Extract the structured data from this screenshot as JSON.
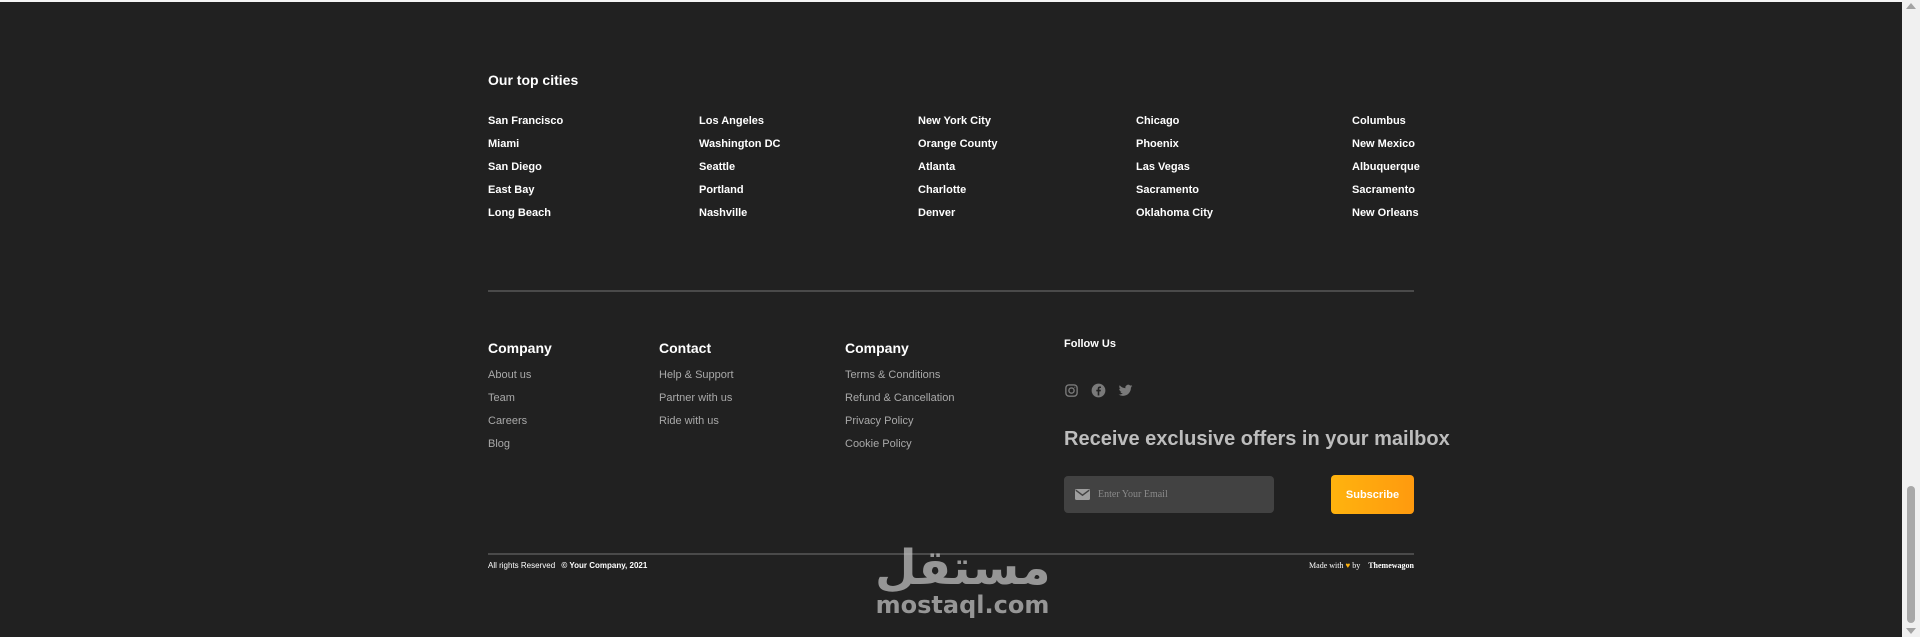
{
  "cities": {
    "heading": "Our top cities",
    "columns": [
      [
        "San Francisco",
        "Miami",
        "San Diego",
        "East Bay",
        "Long Beach"
      ],
      [
        "Los Angeles",
        "Washington DC",
        "Seattle",
        "Portland",
        "Nashville"
      ],
      [
        "New York City",
        "Orange County",
        "Atlanta",
        "Charlotte",
        "Denver"
      ],
      [
        "Chicago",
        "Phoenix",
        "Las Vegas",
        "Sacramento",
        "Oklahoma City"
      ],
      [
        "Columbus",
        "New Mexico",
        "Albuquerque",
        "Sacramento",
        "New Orleans"
      ]
    ]
  },
  "footer": {
    "company1": {
      "title": "Company",
      "links": [
        "About us",
        "Team",
        "Careers",
        "Blog"
      ]
    },
    "contact": {
      "title": "Contact",
      "links": [
        "Help & Support",
        "Partner with us",
        "Ride with us"
      ]
    },
    "company2": {
      "title": "Company",
      "links": [
        "Terms & Conditions",
        "Refund & Cancellation",
        "Privacy Policy",
        "Cookie Policy"
      ]
    },
    "follow": {
      "title": "Follow Us",
      "icons": [
        "instagram-icon",
        "facebook-icon",
        "twitter-icon"
      ]
    },
    "newsletter": {
      "heading": "Receive exclusive offers in your mailbox",
      "placeholder": "Enter Your Email",
      "button": "Subscribe"
    }
  },
  "bottom": {
    "rights": "All rights Reserved",
    "copyright": "© Your Company, 2021",
    "made_with": "Made with",
    "heart": "♥",
    "by": "by",
    "author": "Themewagon"
  },
  "watermark": {
    "arabic": "مستقل",
    "latin": "mostaql.com"
  },
  "colors": {
    "background": "#212121",
    "accent": "#ffb30e",
    "muted_text": "#a9a9a9",
    "heading_muted": "#bdbdbd"
  }
}
